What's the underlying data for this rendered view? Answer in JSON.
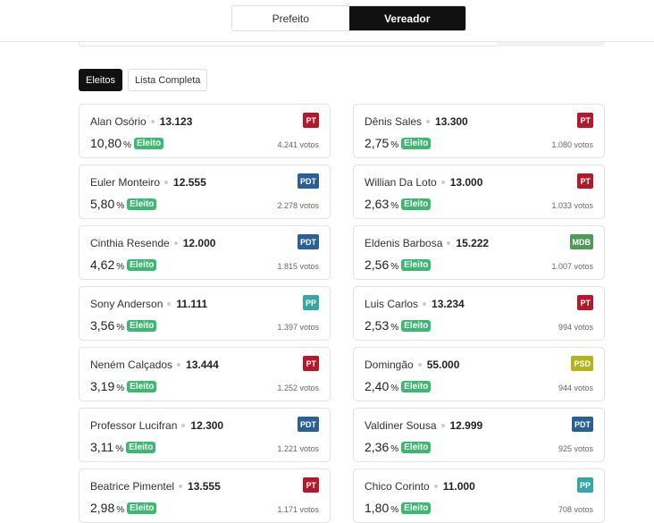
{
  "top_tabs": [
    {
      "label": "Prefeito",
      "active": false
    },
    {
      "label": "Vereador",
      "active": true
    }
  ],
  "filter_tabs": [
    {
      "label": "Eleitos",
      "active": true
    },
    {
      "label": "Lista Completa",
      "active": false
    }
  ],
  "colors": {
    "PT": "#b5172b",
    "PDT": "#2a5f98",
    "PP": "#35a7a6",
    "MDB": "#4f9a56",
    "PSD": "#b4b319",
    "eleito_badge": "#3aba6f"
  },
  "eleito_label": "Eleito",
  "pct_symbol": "%",
  "candidates": [
    {
      "name": "Alan Osório",
      "number": "13.123",
      "pct": "10,80",
      "party": "PT",
      "votes": "4.241 votos"
    },
    {
      "name": "Dênis Sales",
      "number": "13.300",
      "pct": "2,75",
      "party": "PT",
      "votes": "1.080 votos"
    },
    {
      "name": "Euler Monteiro",
      "number": "12.555",
      "pct": "5,80",
      "party": "PDT",
      "votes": "2.278 votos"
    },
    {
      "name": "Willian Da Loto",
      "number": "13.000",
      "pct": "2,63",
      "party": "PT",
      "votes": "1.033 votos"
    },
    {
      "name": "Cinthia Resende",
      "number": "12.000",
      "pct": "4,62",
      "party": "PDT",
      "votes": "1.815 votos"
    },
    {
      "name": "Eldenis Barbosa",
      "number": "15.222",
      "pct": "2,56",
      "party": "MDB",
      "votes": "1.007 votos"
    },
    {
      "name": "Sony Anderson",
      "number": "11.111",
      "pct": "3,56",
      "party": "PP",
      "votes": "1.397 votos"
    },
    {
      "name": "Luis Carlos",
      "number": "13.234",
      "pct": "2,53",
      "party": "PT",
      "votes": "994 votos"
    },
    {
      "name": "Neném Calçados",
      "number": "13.444",
      "pct": "3,19",
      "party": "PT",
      "votes": "1.252 votos"
    },
    {
      "name": "Domingão",
      "number": "55.000",
      "pct": "2,40",
      "party": "PSD",
      "votes": "944 votos"
    },
    {
      "name": "Professor Lucifran",
      "number": "12.300",
      "pct": "3,11",
      "party": "PDT",
      "votes": "1.221 votos"
    },
    {
      "name": "Valdiner Sousa",
      "number": "12.999",
      "pct": "2,36",
      "party": "PDT",
      "votes": "925 votos"
    },
    {
      "name": "Beatrice Pimentel",
      "number": "13.555",
      "pct": "2,98",
      "party": "PT",
      "votes": "1.171 votos"
    },
    {
      "name": "Chico Corinto",
      "number": "11.000",
      "pct": "1,80",
      "party": "PP",
      "votes": "708 votos"
    }
  ]
}
